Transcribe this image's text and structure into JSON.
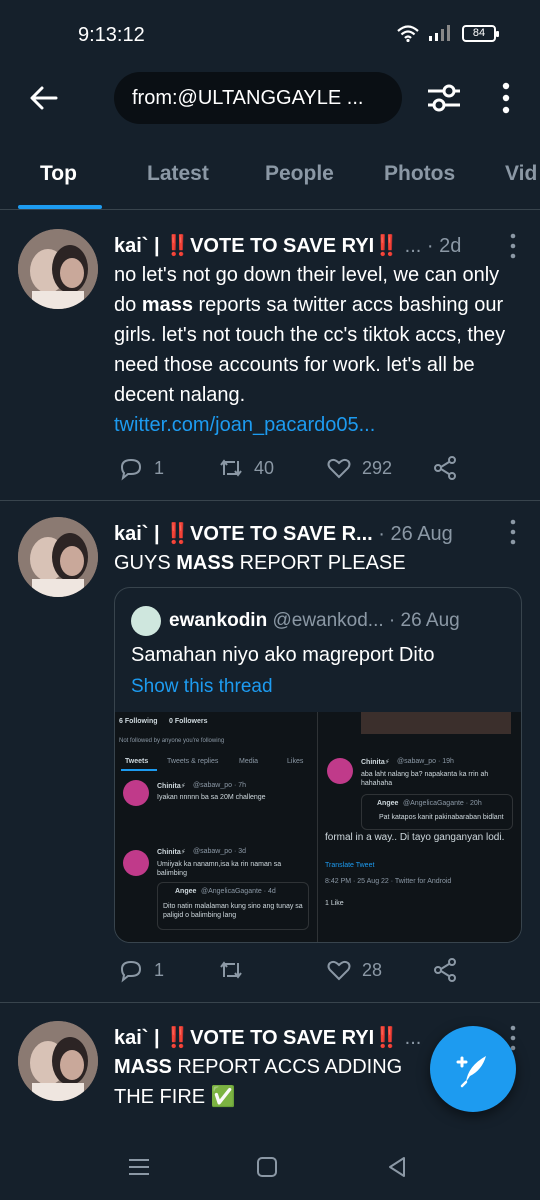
{
  "status_bar": {
    "time": "9:13:12",
    "battery": "84"
  },
  "header": {
    "search_value": "from:@ULTANGGAYLE ...",
    "icons": [
      "back-arrow-icon",
      "filter-sliders-icon",
      "more-vertical-icon"
    ]
  },
  "tabs": [
    {
      "label": "Top",
      "active": true
    },
    {
      "label": "Latest"
    },
    {
      "label": "People"
    },
    {
      "label": "Photos"
    },
    {
      "label": "Vid"
    }
  ],
  "tweets": [
    {
      "name_prefix": "kai` | ",
      "emoji": "‼️",
      "name_main": "VOTE TO SAVE RYI",
      "suffix": " ... · ",
      "time": "2d",
      "text_1": "no let's not go down their level, we can only do ",
      "bold_1": "mass",
      "text_2": " reports sa twitter accs bashing our girls. let's not touch the cc's tiktok accs, they need those accounts for work. let's all be decent nalang.",
      "link": "twitter.com/joan_pacardo05...",
      "replies": "1",
      "retweets": "40",
      "likes": "292"
    },
    {
      "name_prefix": "kai` | ",
      "emoji": "‼️",
      "name_main": "VOTE TO SAVE R...",
      "suffix": " · ",
      "time": "26 Aug",
      "text_1": "GUYS ",
      "bold_1": "MASS",
      "text_2": " REPORT PLEASE",
      "replies": "1",
      "retweets": "",
      "likes": "28",
      "quote": {
        "name": "ewankodin",
        "handle": "@ewankod...",
        "time": "26 Aug",
        "text": "Samahan niyo ako magreport Dito",
        "show_thread": "Show this thread",
        "screenshot": {
          "following": "6 Following",
          "followers": "0 Followers",
          "not_followed": "Not followed by anyone you're following",
          "tabs": [
            "Tweets",
            "Tweets & replies",
            "Media",
            "Likes"
          ],
          "t1_name": "Chinita⚡",
          "t1_handle": "@sabaw_po · 7h",
          "t1_text": "Iyakan nnnnn ba sa 20M challenge",
          "t2_name": "Chinita⚡",
          "t2_handle": "@sabaw_po · 3d",
          "t2_text": "Umiiyak ka nanamn,isa ka rin naman sa balimbing",
          "t2_q_name": "Angee",
          "t2_q_handle": "@AngelicaGagante · 4d",
          "t2_q_text": "Dito natin malalaman kung sino ang tunay sa paligid o balimbing lang",
          "r_name": "Chinita⚡",
          "r_handle": "@sabaw_po · 19h",
          "r_text": "aba laht nalang ba? napakanta ka rrin ah hahahaha",
          "r_q_name": "Angee",
          "r_q_handle": "@AngelicaGagante · 20h",
          "r_q_text": "Pat katapos kanit pakinabaraban bidlant",
          "r_big": "formal in a way.. Di tayo ganganyan lodi.",
          "r_translate": "Translate Tweet",
          "r_time": "8:42 PM · 25 Aug 22 · Twitter for Android",
          "r_likes": "1 Like"
        }
      }
    },
    {
      "name_prefix": "kai` | ",
      "emoji": "‼️",
      "name_main": "VOTE TO SAVE RYI",
      "suffix": " ...",
      "time": "",
      "bold_1": "MASS",
      "text_2": " REPORT ACCS ADDING",
      "text_3": "THE FIRE ✅"
    }
  ],
  "colors": {
    "background": "#15202b",
    "accent": "#1d9bf0",
    "muted": "#8b98a5",
    "divider": "#38444d",
    "alert": "#f4212e"
  }
}
